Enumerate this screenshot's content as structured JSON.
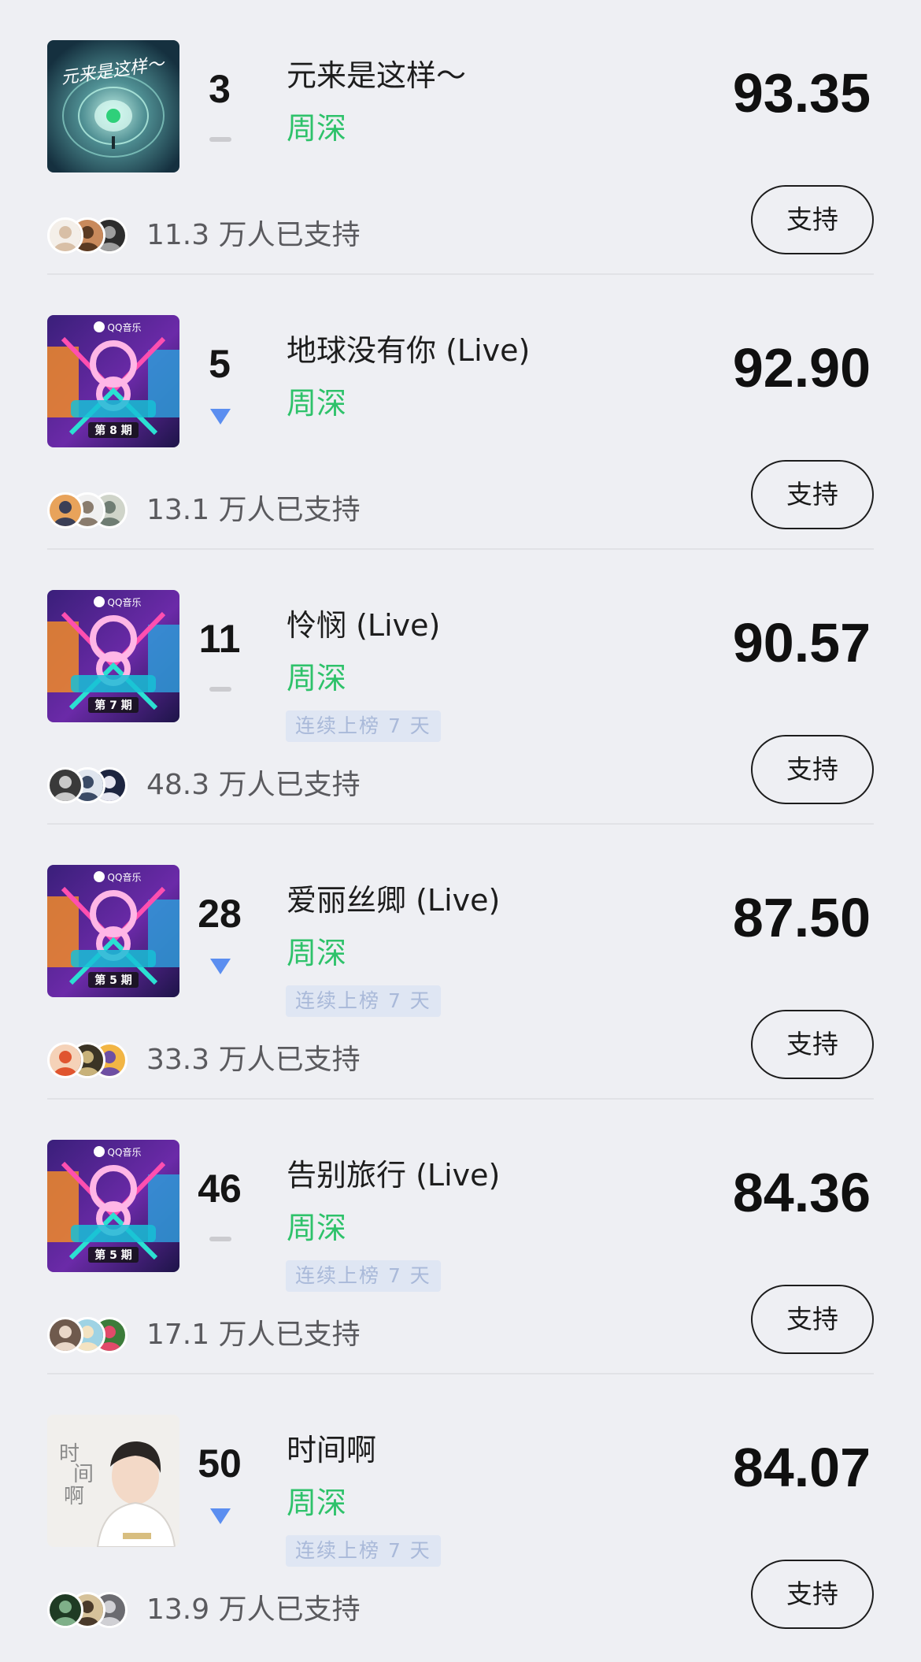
{
  "colors": {
    "background": "#eeeff3",
    "artist": "#2ec26a",
    "trend_down": "#5b8ef0",
    "trend_flat": "#cbcbcf",
    "tag_bg": "#dfe6f3",
    "tag_text": "#a9b9d9"
  },
  "songs": [
    {
      "rank": "3",
      "trend": "flat",
      "title": "元来是这样～",
      "artist": "周深",
      "tag": "",
      "score": "93.35",
      "support_label": "支持",
      "supporters": "11.3 万人已支持",
      "cover": {
        "style": "tunnel",
        "text": "元来是这样～",
        "episode": ""
      },
      "avatar_colors": [
        [
          "#f4efe9",
          "#d8bfa6"
        ],
        [
          "#c98a5c",
          "#5b3a22"
        ],
        [
          "#2d2d2d",
          "#9e9e9e"
        ]
      ]
    },
    {
      "rank": "5",
      "trend": "down",
      "title": "地球没有你 (Live)",
      "artist": "周深",
      "tag": "",
      "score": "92.90",
      "support_label": "支持",
      "supporters": "13.1 万人已支持",
      "cover": {
        "style": "show",
        "text": "QQ音乐",
        "episode": "第 8 期"
      },
      "avatar_colors": [
        [
          "#e8a35b",
          "#3b3f56"
        ],
        [
          "#f0f0f0",
          "#8a7c6d"
        ],
        [
          "#cfd4c9",
          "#6f7d73"
        ]
      ]
    },
    {
      "rank": "11",
      "trend": "flat",
      "title": "怜悯 (Live)",
      "artist": "周深",
      "tag": "连续上榜 7 天",
      "score": "90.57",
      "support_label": "支持",
      "supporters": "48.3 万人已支持",
      "cover": {
        "style": "show",
        "text": "QQ音乐",
        "episode": "第 7 期"
      },
      "avatar_colors": [
        [
          "#3a3a3a",
          "#c9c9c9"
        ],
        [
          "#dfe5ee",
          "#3b4b66"
        ],
        [
          "#1d2540",
          "#e6e6f0"
        ]
      ]
    },
    {
      "rank": "28",
      "trend": "down",
      "title": "爱丽丝卿 (Live)",
      "artist": "周深",
      "tag": "连续上榜 7 天",
      "score": "87.50",
      "support_label": "支持",
      "supporters": "33.3 万人已支持",
      "cover": {
        "style": "show",
        "text": "QQ音乐",
        "episode": "第 5 期"
      },
      "avatar_colors": [
        [
          "#f5d2b8",
          "#e0552f"
        ],
        [
          "#3b3425",
          "#c8b27a"
        ],
        [
          "#f2b544",
          "#6e4fa3"
        ]
      ]
    },
    {
      "rank": "46",
      "trend": "flat",
      "title": "告别旅行 (Live)",
      "artist": "周深",
      "tag": "连续上榜 7 天",
      "score": "84.36",
      "support_label": "支持",
      "supporters": "17.1 万人已支持",
      "cover": {
        "style": "show",
        "text": "QQ音乐",
        "episode": "第 5 期"
      },
      "avatar_colors": [
        [
          "#6f5a4d",
          "#e9d7c8"
        ],
        [
          "#9fd3e4",
          "#f3e3c2"
        ],
        [
          "#3c7c3a",
          "#e14a6a"
        ]
      ]
    },
    {
      "rank": "50",
      "trend": "down",
      "title": "时间啊",
      "artist": "周深",
      "tag": "连续上榜 7 天",
      "score": "84.07",
      "support_label": "支持",
      "supporters": "13.9 万人已支持",
      "cover": {
        "style": "portrait",
        "text": "时间啊",
        "episode": ""
      },
      "avatar_colors": [
        [
          "#1f3b24",
          "#7fb089"
        ],
        [
          "#d6c29a",
          "#4a3a2a"
        ],
        [
          "#6b6b70",
          "#d0d0d4"
        ]
      ]
    }
  ]
}
